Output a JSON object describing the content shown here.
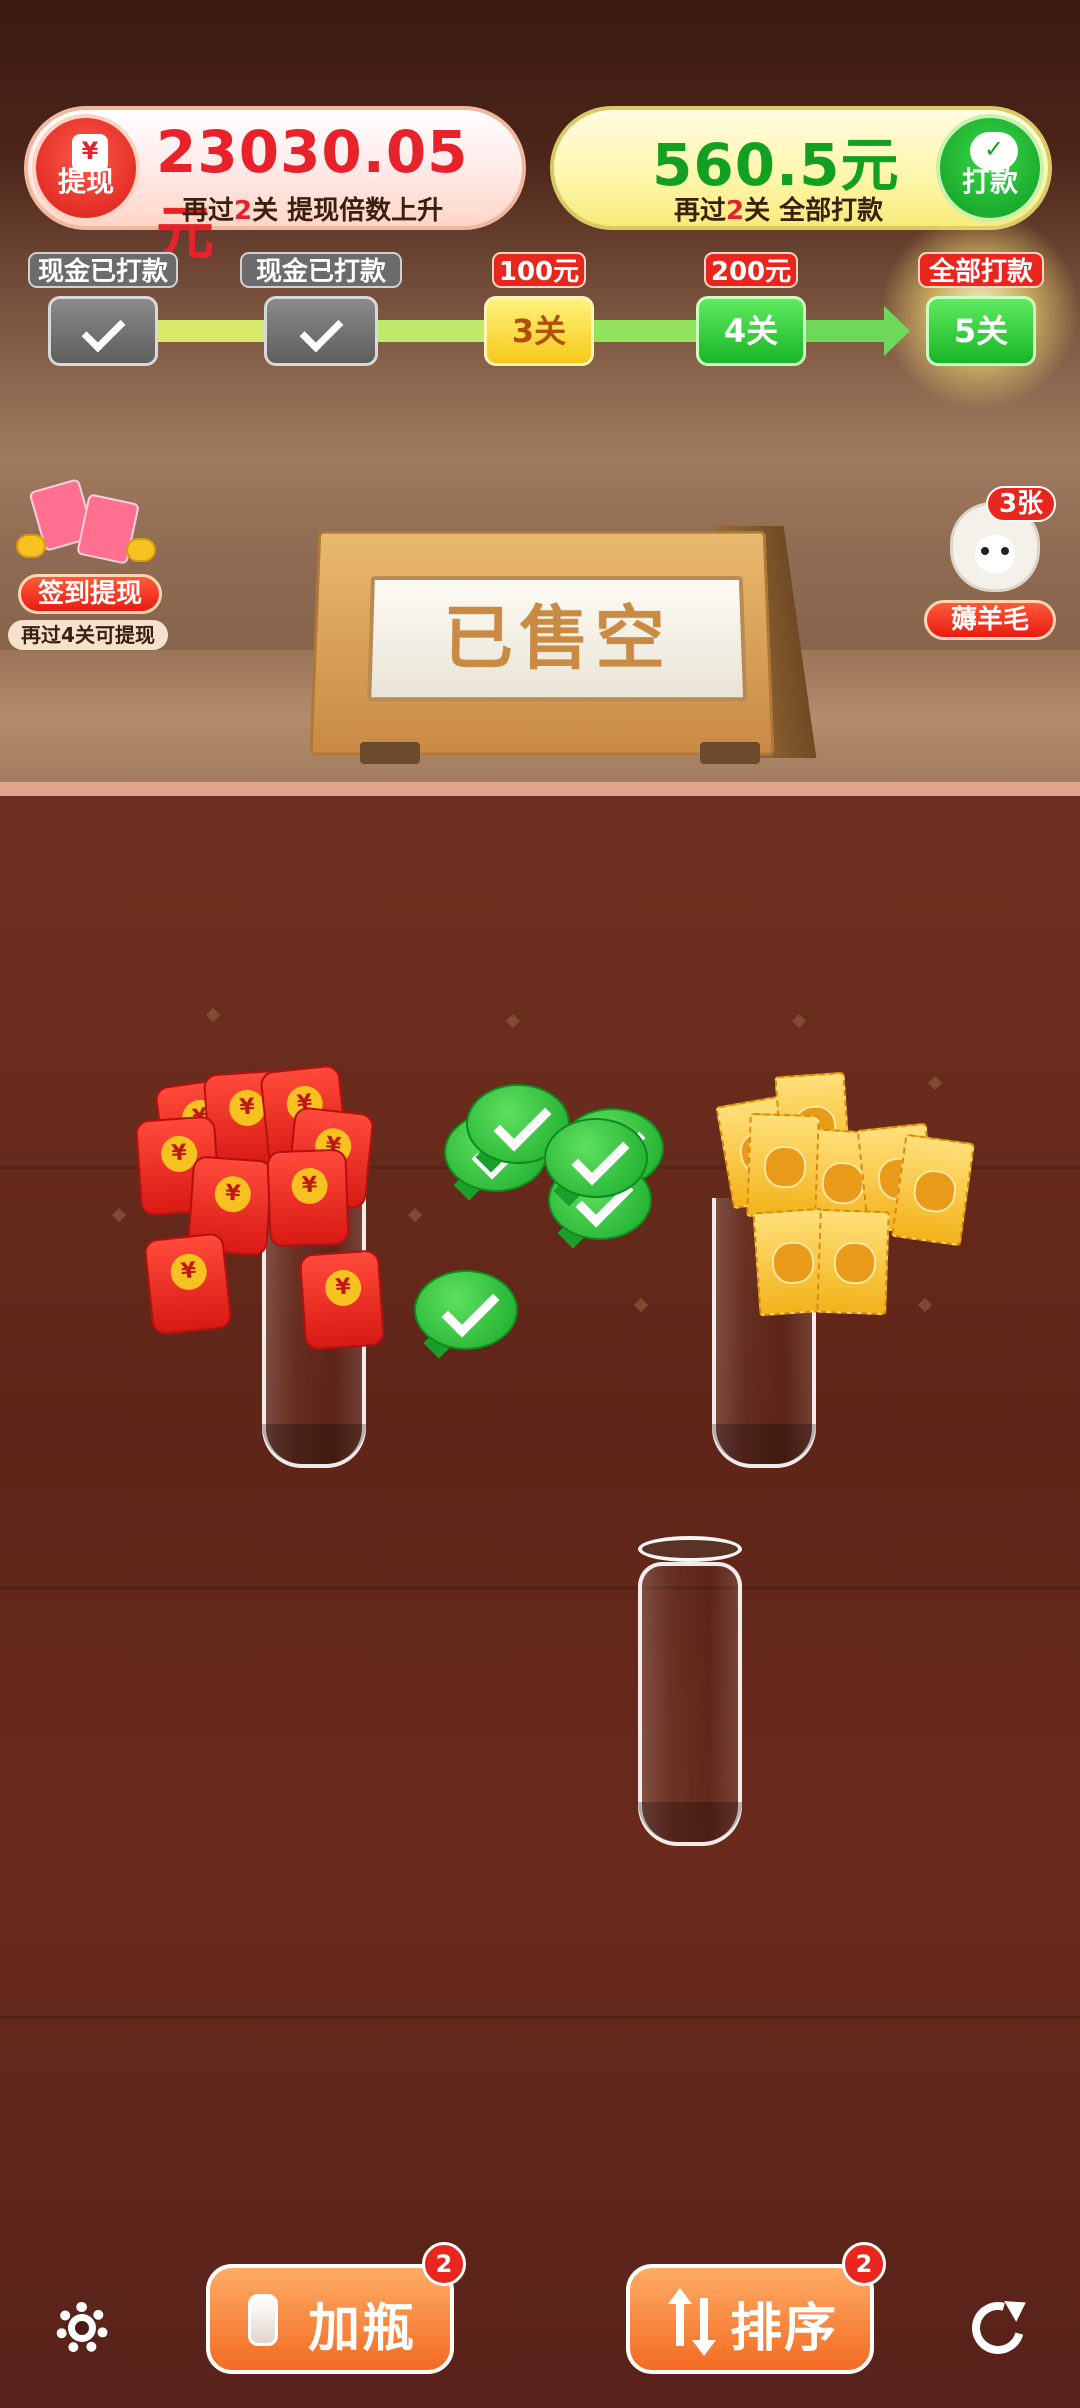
{
  "top_left_card": {
    "amount": "23030.05元",
    "sub_prefix": "再过",
    "sub_count": "2",
    "sub_suffix": "关 提现倍数上升",
    "button_label": "提现",
    "button_icon": "yuan-envelope-icon"
  },
  "top_right_card": {
    "amount": "560.5元",
    "sub_prefix": "再过",
    "sub_count": "2",
    "sub_suffix": "关 全部打款",
    "button_label": "打款",
    "button_icon": "wechat-check-icon"
  },
  "progress": {
    "stages": [
      {
        "tag": "现金已打款",
        "box": "",
        "state": "done"
      },
      {
        "tag": "现金已打款",
        "box": "",
        "state": "done"
      },
      {
        "tag": "100元",
        "box": "3关",
        "state": "current"
      },
      {
        "tag": "200元",
        "box": "4关",
        "state": "locked"
      },
      {
        "tag": "全部打款",
        "box": "5关",
        "state": "final"
      }
    ]
  },
  "signin": {
    "button_label": "签到提现",
    "sub_label": "再过4关可提现"
  },
  "wool": {
    "badge": "3张",
    "button_label": "薅羊毛"
  },
  "sign_board": {
    "text": "已售空"
  },
  "bottles": {
    "count": 3,
    "contents": [
      "red-envelopes",
      "empty",
      "coupons"
    ]
  },
  "bottom_bar": {
    "add_bottle_label": "加瓶",
    "add_bottle_badge": "2",
    "sort_label": "排序",
    "sort_badge": "2",
    "settings_icon": "gear-icon",
    "refresh_icon": "refresh-icon"
  },
  "colors": {
    "accent_red": "#e8222a",
    "accent_green": "#12a020",
    "button_orange": "#f36b22"
  }
}
